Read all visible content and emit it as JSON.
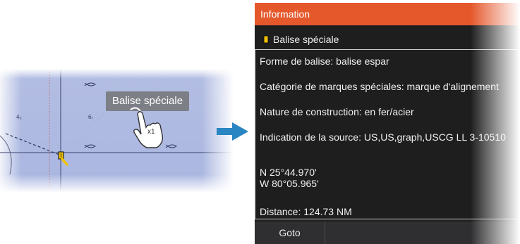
{
  "chart": {
    "depths": [
      "4₅",
      "6₇"
    ],
    "tooltip": "Balise spéciale",
    "tap_count": "x1"
  },
  "panel": {
    "title": "Information",
    "subtitle": "Balise spéciale",
    "lines": {
      "shape": "Forme de balise: balise espar",
      "category": "Catégorie de marques spéciales: marque d'alignement",
      "construction": "Nature de construction: en fer/acier",
      "source": "Indication de la source: US,US,graph,USCG LL 3-10510",
      "lat": "N  25°44.970'",
      "lon": "W  80°05.965'",
      "distance": "Distance: 124.73 NM"
    },
    "goto_label": "Goto"
  },
  "colors": {
    "header": "#e4582c",
    "panel_bg": "#1e1e1f",
    "chart_water": "#aeb9e1",
    "arrow": "#2a86c2"
  }
}
